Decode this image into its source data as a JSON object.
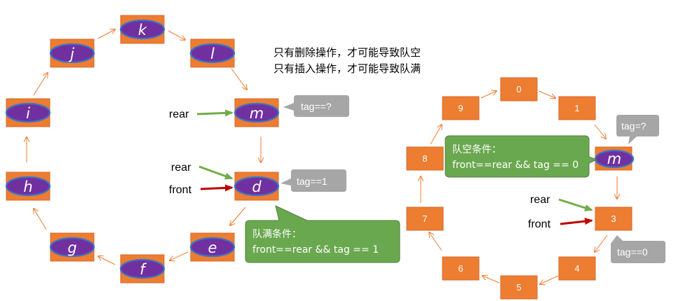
{
  "notes": {
    "line1": "只有删除操作，才可能导致队空",
    "line2": "只有插入操作，才可能导致队满"
  },
  "left_ring": {
    "nodes": [
      "k",
      "l",
      "m",
      "d",
      "e",
      "f",
      "g",
      "h",
      "i",
      "j"
    ],
    "pointers": {
      "rear_top": "rear",
      "rear_mid": "rear",
      "front_mid": "front"
    },
    "bubbles": {
      "tag_unknown": "tag==?",
      "tag_one": "tag==1"
    },
    "condition": {
      "title": "队满条件：",
      "expr": "front==rear && tag == 1"
    }
  },
  "right_ring": {
    "nodes": [
      "0",
      "1",
      "m",
      "3",
      "4",
      "5",
      "6",
      "7",
      "8",
      "9"
    ],
    "pointers": {
      "rear": "rear",
      "front": "front"
    },
    "bubbles": {
      "tag_unknown": "tag=?",
      "tag_zero": "tag==0"
    },
    "condition": {
      "title": "队空条件：",
      "expr": "front==rear && tag == 0"
    }
  },
  "colors": {
    "node_fill": "#ED7D31",
    "oval_fill": "#7030A0",
    "oval_stroke": "#3D73C4",
    "rear_arrow": "#70AD47",
    "front_arrow": "#C00000",
    "green_bubble": "#6AA84F",
    "grey_bubble": "#A6A6A6"
  }
}
